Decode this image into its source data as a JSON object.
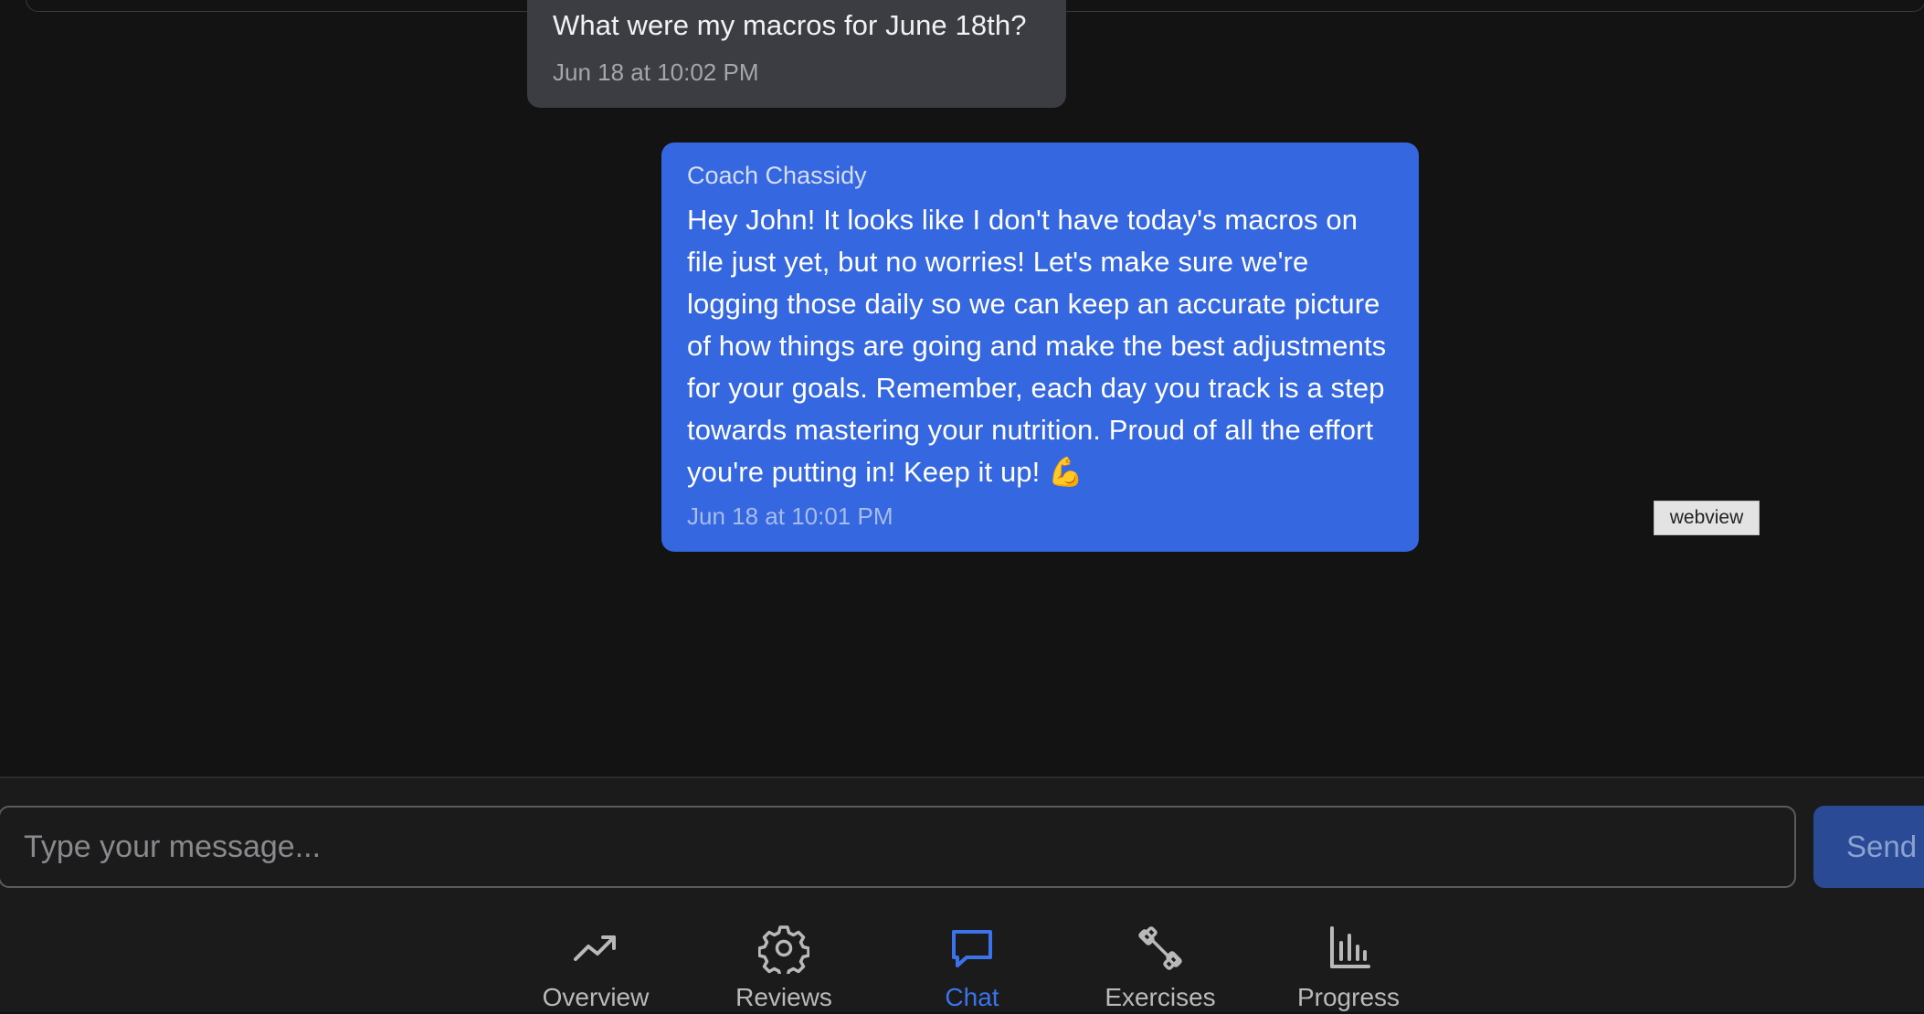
{
  "thread": {
    "user_message": {
      "text": "What were my macros for June 18th?",
      "timestamp": "Jun 18 at 10:02 PM"
    },
    "coach_message": {
      "sender": "Coach Chassidy",
      "text": "Hey John! It looks like I don't have today's macros on file just yet, but no worries! Let's make sure we're logging those daily so we can keep an accurate picture of how things are going and make the best adjustments for your goals. Remember, each day you track is a step towards mastering your nutrition. Proud of all the effort you're putting in! Keep it up! 💪",
      "timestamp": "Jun 18 at 10:01 PM"
    }
  },
  "webview_tag": "webview",
  "composer": {
    "placeholder": "Type your message...",
    "value": "",
    "send_label": "Send"
  },
  "nav": {
    "tabs": [
      {
        "label": "Overview",
        "icon": "trending-up-icon",
        "active": false
      },
      {
        "label": "Reviews",
        "icon": "gear-icon",
        "active": false
      },
      {
        "label": "Chat",
        "icon": "chat-bubble-icon",
        "active": true
      },
      {
        "label": "Exercises",
        "icon": "dumbbell-icon",
        "active": false
      },
      {
        "label": "Progress",
        "icon": "bar-chart-icon",
        "active": false
      }
    ]
  },
  "colors": {
    "background": "#131313",
    "user_bubble": "#3b3d42",
    "coach_bubble": "#3467e0",
    "accent": "#3a73ea",
    "send_button": "#2a4a96"
  }
}
